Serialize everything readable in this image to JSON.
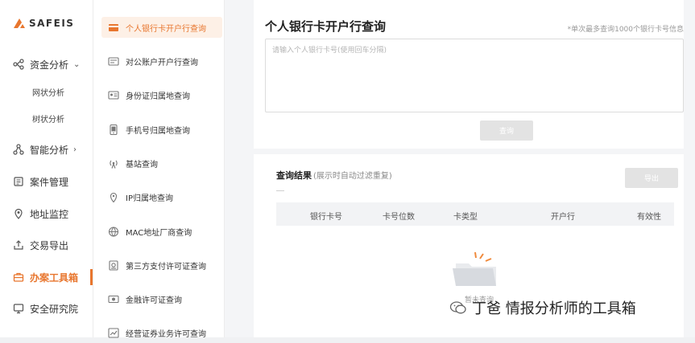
{
  "brand": {
    "logo_text": "SAFEIS",
    "accent": "#e8762e"
  },
  "sidebar": {
    "items": [
      {
        "label": "资金分析",
        "icon": "flow-icon",
        "chevron": "⌄",
        "subitems": [
          "网状分析",
          "树状分析"
        ]
      },
      {
        "label": "智能分析",
        "icon": "nodes-icon",
        "chevron": "›"
      },
      {
        "label": "案件管理",
        "icon": "case-icon"
      },
      {
        "label": "地址监控",
        "icon": "location-icon"
      },
      {
        "label": "交易导出",
        "icon": "export-icon"
      },
      {
        "label": "办案工具箱",
        "icon": "toolbox-icon",
        "active": true
      },
      {
        "label": "安全研究院",
        "icon": "monitor-icon"
      }
    ]
  },
  "tools": [
    {
      "label": "个人银行卡开户行查询",
      "icon": "bank-card-icon",
      "active": true
    },
    {
      "label": "对公账户开户行查询",
      "icon": "building-icon"
    },
    {
      "label": "身份证归属地查询",
      "icon": "id-card-icon"
    },
    {
      "label": "手机号归属地查询",
      "icon": "phone-icon"
    },
    {
      "label": "基站查询",
      "icon": "antenna-icon"
    },
    {
      "label": "IP归属地查询",
      "icon": "ip-pin-icon"
    },
    {
      "label": "MAC地址厂商查询",
      "icon": "globe-icon"
    },
    {
      "label": "第三方支付许可证查询",
      "icon": "payment-icon"
    },
    {
      "label": "金融许可证查询",
      "icon": "finance-icon"
    },
    {
      "label": "经营证券业务许可查询",
      "icon": "securities-icon"
    }
  ],
  "query": {
    "title": "个人银行卡开户行查询",
    "limit_note": "*单次最多查询1000个银行卡号信息",
    "placeholder": "请输入个人银行卡号(使用回车分隔)",
    "button": "查询"
  },
  "results": {
    "title": "查询结果",
    "hint": "(展示时自动过滤重复)",
    "export_button": "导出",
    "columns": [
      "银行卡号",
      "卡号位数",
      "卡类型",
      "开户行",
      "有效性"
    ],
    "empty_text": "暂未查询"
  },
  "watermark": {
    "text": "丁爸 情报分析师的工具箱",
    "icon": "wechat-icon"
  }
}
